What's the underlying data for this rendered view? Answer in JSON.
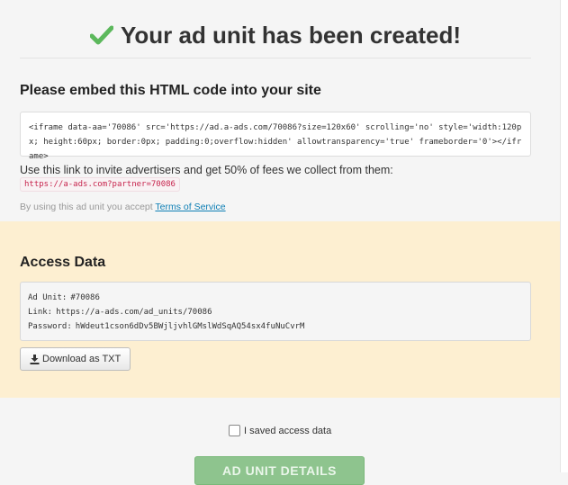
{
  "header": {
    "title": "Your ad unit has been created!",
    "icon": "check-icon",
    "icon_color": "#5cb85c"
  },
  "embed": {
    "heading": "Please embed this HTML code into your site",
    "code": "<iframe data-aa='70086' src='https://ad.a-ads.com/70086?size=120x60' scrolling='no' style='width:120px; height:60px; border:0px; padding:0;overflow:hidden' allowtransparency='true' frameborder='0'></iframe>",
    "invite_text": "Use this link to invite advertisers and get 50% of fees we collect from them:",
    "partner_link": "https://a-ads.com?partner=70086",
    "terms_prefix": "By using this ad unit you accept",
    "terms_link": "Terms of Service"
  },
  "access": {
    "heading": "Access Data",
    "ad_unit_label": "Ad Unit:",
    "ad_unit_value": "#70086",
    "link_label": "Link:",
    "link_value": "https://a-ads.com/ad_units/70086",
    "password_label": "Password:",
    "password_value": "hWdeut1cson6dDv5BWjljvhlGMslWdSqAQ54sx4fuNuCvrM",
    "download_label": "Download as TXT",
    "download_icon": "download-icon",
    "panel_color": "#fdefd1"
  },
  "footer": {
    "saved_label": "I saved access data",
    "saved_checked": false,
    "details_label": "AD UNIT DETAILS",
    "details_color": "#8ec48e"
  }
}
